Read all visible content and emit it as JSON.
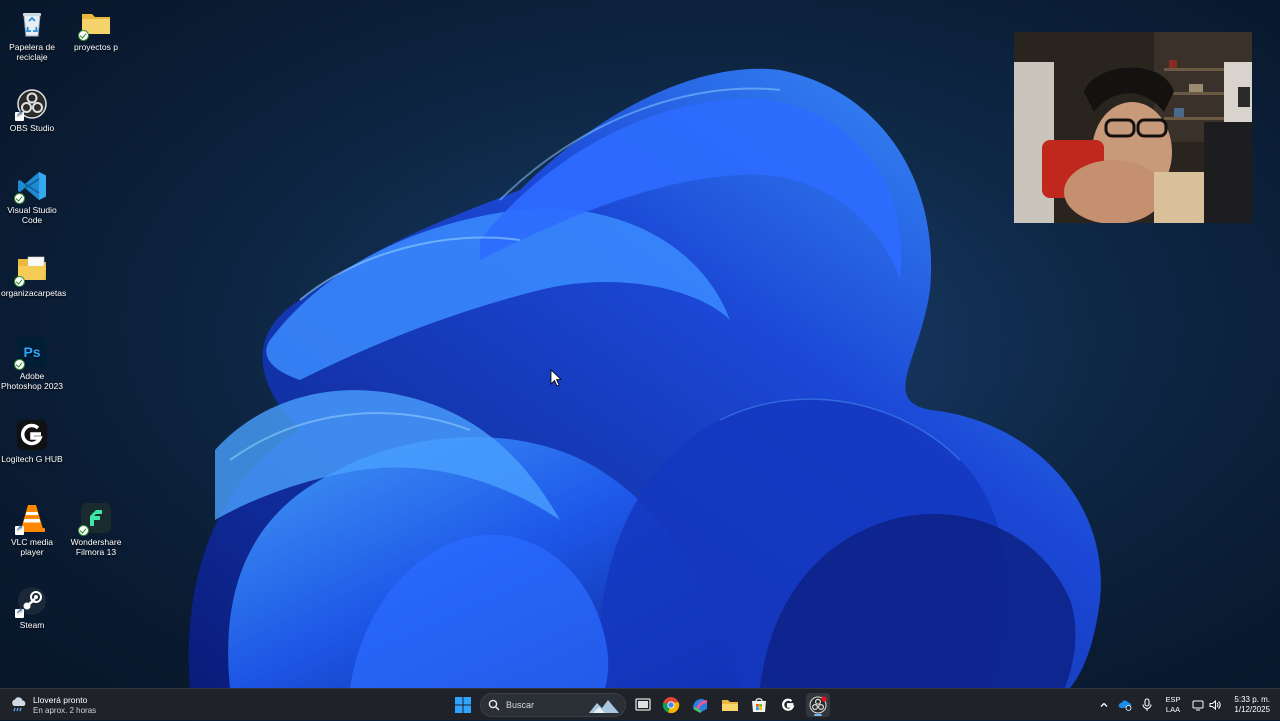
{
  "desktop": {
    "icons": [
      {
        "label": "Papelera de reciclaje",
        "icon": "recycle-bin-icon"
      },
      {
        "label": "proyectos p",
        "icon": "folder-icon"
      },
      {
        "label": "OBS Studio",
        "icon": "obs-icon"
      },
      {
        "label": "Visual Studio Code",
        "icon": "vscode-icon"
      },
      {
        "label": "organizacarpetas",
        "icon": "folder-app-icon"
      },
      {
        "label": "Adobe Photoshop 2023",
        "icon": "photoshop-icon"
      },
      {
        "label": "Logitech G HUB",
        "icon": "logitech-icon"
      },
      {
        "label": "VLC media player",
        "icon": "vlc-icon"
      },
      {
        "label": "Wondershare Filmora 13",
        "icon": "filmora-icon"
      },
      {
        "label": "Steam",
        "icon": "steam-icon"
      }
    ]
  },
  "taskbar": {
    "weather": {
      "line1": "Lloverá pronto",
      "line2": "En aprox. 2 horas",
      "icon": "rain-cloud-icon"
    },
    "search_placeholder": "Buscar",
    "apps": [
      "windows-start-icon",
      "task-view-icon",
      "chrome-icon",
      "microsoft-365-icon",
      "file-explorer-icon",
      "microsoft-store-icon",
      "logitech-icon",
      "obs-icon"
    ],
    "tray": {
      "lang_line1": "ESP",
      "lang_line2": "LAA",
      "time": "5:33 p. m.",
      "date": "1/12/2025"
    }
  },
  "colors": {
    "taskbar": "#1f2228",
    "accent": "#76b9ed",
    "wallpaper_bloom": "#1e63ff"
  }
}
